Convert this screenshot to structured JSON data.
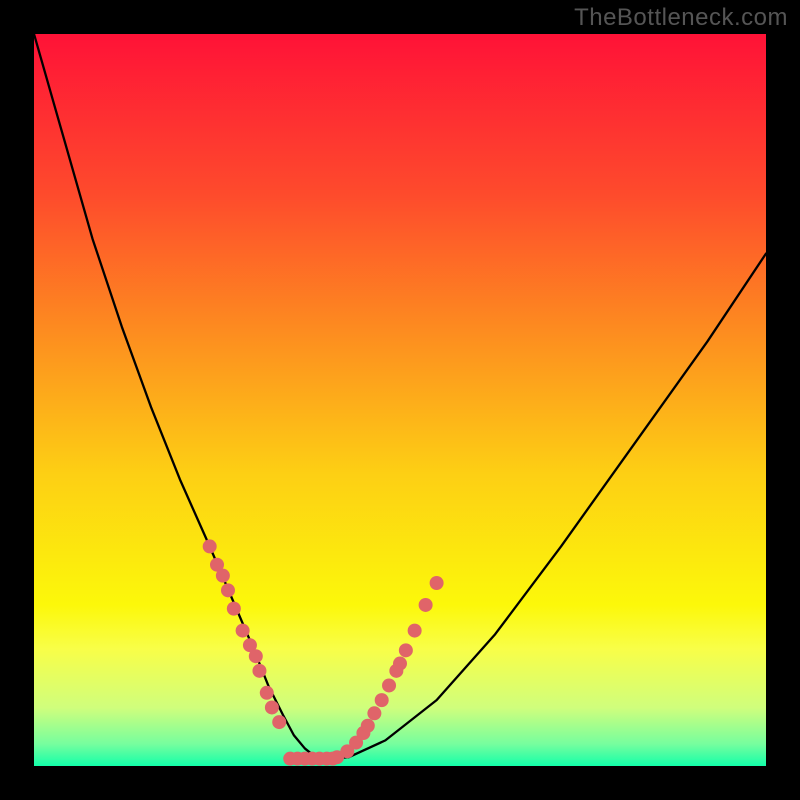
{
  "watermark": "TheBottleneck.com",
  "chart_data": {
    "type": "line",
    "title": "",
    "xlabel": "",
    "ylabel": "",
    "xlim": [
      0,
      100
    ],
    "ylim": [
      0,
      100
    ],
    "background_gradient": {
      "type": "vertical",
      "stops": [
        {
          "pos": 0.0,
          "color": "#ff1237"
        },
        {
          "pos": 0.22,
          "color": "#fe4b2c"
        },
        {
          "pos": 0.4,
          "color": "#fd8a20"
        },
        {
          "pos": 0.6,
          "color": "#fdcf14"
        },
        {
          "pos": 0.78,
          "color": "#fcf80a"
        },
        {
          "pos": 0.84,
          "color": "#f8fe48"
        },
        {
          "pos": 0.92,
          "color": "#d0fe7c"
        },
        {
          "pos": 0.97,
          "color": "#76fe9e"
        },
        {
          "pos": 1.0,
          "color": "#13ffa9"
        }
      ]
    },
    "series": [
      {
        "name": "bottleneck-curve",
        "stroke": "#000000",
        "x": [
          0,
          4,
          8,
          12,
          16,
          20,
          24,
          27,
          30,
          32,
          34,
          35.5,
          37,
          38.5,
          40,
          43,
          48,
          55,
          63,
          72,
          82,
          92,
          100
        ],
        "y": [
          100,
          86,
          72,
          60,
          49,
          39,
          30,
          23,
          16,
          11,
          7,
          4.2,
          2.4,
          1.2,
          1.0,
          1.2,
          3.5,
          9,
          18,
          30,
          44,
          58,
          70
        ]
      }
    ],
    "scatter": {
      "name": "sample-points",
      "color": "#e06469",
      "radius": 7,
      "points": [
        {
          "x": 24.0,
          "y": 30.0
        },
        {
          "x": 25.0,
          "y": 27.5
        },
        {
          "x": 25.8,
          "y": 26.0
        },
        {
          "x": 26.5,
          "y": 24.0
        },
        {
          "x": 27.3,
          "y": 21.5
        },
        {
          "x": 28.5,
          "y": 18.5
        },
        {
          "x": 29.5,
          "y": 16.5
        },
        {
          "x": 30.3,
          "y": 15.0
        },
        {
          "x": 30.8,
          "y": 13.0
        },
        {
          "x": 31.8,
          "y": 10.0
        },
        {
          "x": 32.5,
          "y": 8.0
        },
        {
          "x": 33.5,
          "y": 6.0
        },
        {
          "x": 35.0,
          "y": 1.0
        },
        {
          "x": 36.0,
          "y": 1.0
        },
        {
          "x": 37.0,
          "y": 1.0
        },
        {
          "x": 38.0,
          "y": 1.0
        },
        {
          "x": 39.0,
          "y": 1.0
        },
        {
          "x": 40.0,
          "y": 1.0
        },
        {
          "x": 40.8,
          "y": 1.0
        },
        {
          "x": 41.4,
          "y": 1.2
        },
        {
          "x": 42.8,
          "y": 2.0
        },
        {
          "x": 44.0,
          "y": 3.2
        },
        {
          "x": 45.0,
          "y": 4.5
        },
        {
          "x": 45.6,
          "y": 5.5
        },
        {
          "x": 46.5,
          "y": 7.2
        },
        {
          "x": 47.5,
          "y": 9.0
        },
        {
          "x": 48.5,
          "y": 11.0
        },
        {
          "x": 49.5,
          "y": 13.0
        },
        {
          "x": 50.0,
          "y": 14.0
        },
        {
          "x": 50.8,
          "y": 15.8
        },
        {
          "x": 52.0,
          "y": 18.5
        },
        {
          "x": 53.5,
          "y": 22.0
        },
        {
          "x": 55.0,
          "y": 25.0
        }
      ]
    }
  }
}
